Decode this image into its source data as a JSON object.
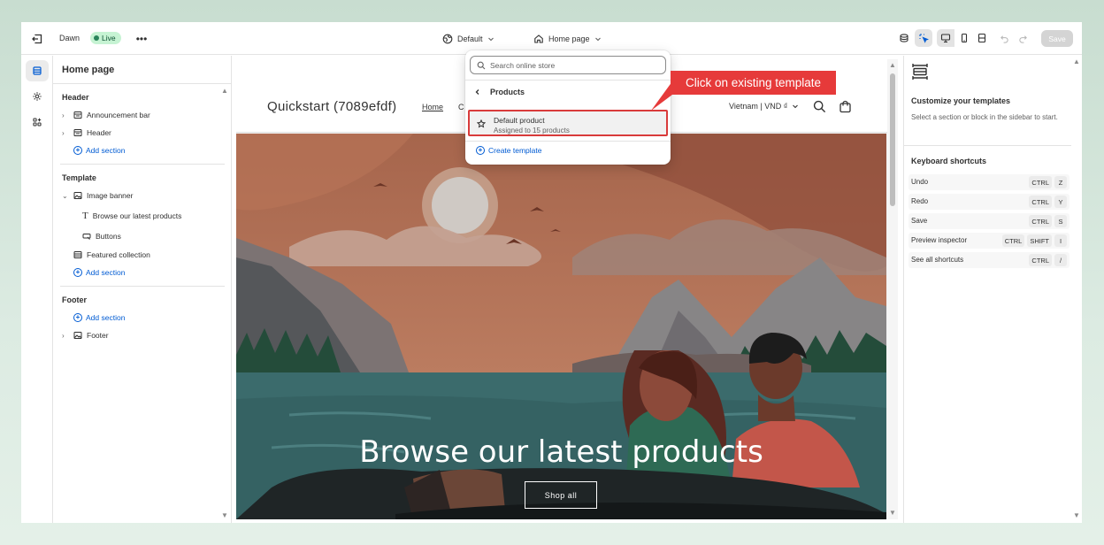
{
  "topbar": {
    "theme_name": "Dawn",
    "live_label": "Live",
    "more_label": "•••",
    "template_label": "Default",
    "page_label": "Home page",
    "save_label": "Save"
  },
  "sidebar": {
    "title": "Home page",
    "header_group": "Header",
    "header_items": [
      "Announcement bar",
      "Header"
    ],
    "add_section": "Add section",
    "template_group": "Template",
    "image_banner": "Image banner",
    "banner_children": [
      "Browse our latest products",
      "Buttons"
    ],
    "featured_collection": "Featured collection",
    "footer_group": "Footer",
    "footer_item": "Footer"
  },
  "store": {
    "logo": "Quickstart (7089efdf)",
    "nav_home": "Home",
    "nav_partial": "C",
    "currency": "Vietnam | VND ₫",
    "hero_title": "Browse our latest products",
    "hero_button": "Shop all"
  },
  "dropdown": {
    "search_placeholder": "Search online store",
    "back_label": "Products",
    "item_title": "Default product",
    "item_subtitle": "Assigned to 15 products",
    "create_label": "Create template"
  },
  "callout": "Click on existing template",
  "right_panel": {
    "title": "Customize your templates",
    "description": "Select a section or block in the sidebar to start.",
    "shortcuts_title": "Keyboard shortcuts",
    "shortcuts": [
      {
        "label": "Undo",
        "keys": [
          "CTRL",
          "Z"
        ]
      },
      {
        "label": "Redo",
        "keys": [
          "CTRL",
          "Y"
        ]
      },
      {
        "label": "Save",
        "keys": [
          "CTRL",
          "S"
        ]
      },
      {
        "label": "Preview inspector",
        "keys": [
          "CTRL",
          "SHIFT",
          "I"
        ]
      },
      {
        "label": "See all shortcuts",
        "keys": [
          "CTRL",
          "/"
        ]
      }
    ]
  },
  "colors": {
    "accent_blue": "#005bd3",
    "live_green": "#c6f3d3",
    "callout_red": "#e63a3a"
  }
}
